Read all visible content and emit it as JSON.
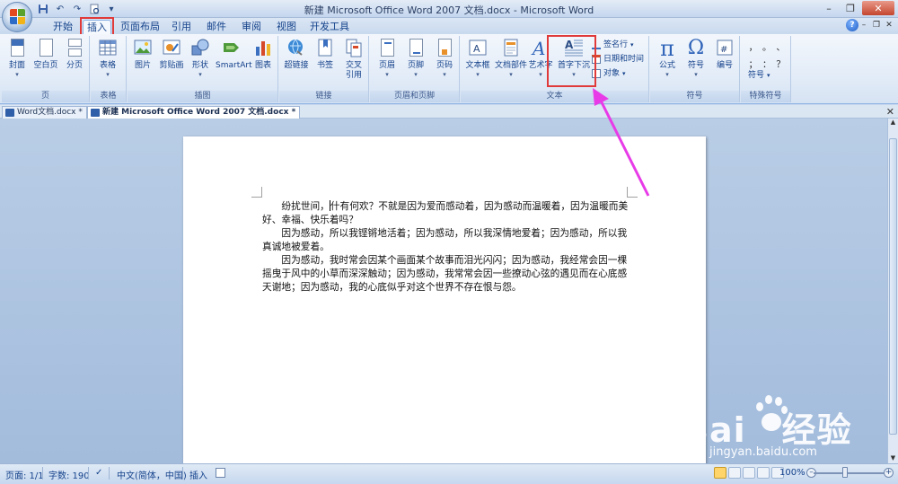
{
  "window": {
    "title": "新建 Microsoft Office Word 2007 文档.docx - Microsoft Word",
    "controls": {
      "minimize": "–",
      "restore": "❐",
      "close": "✕"
    }
  },
  "quick_access": {
    "save": "save-icon",
    "undo": "↶",
    "redo": "↷",
    "customize": "▾"
  },
  "ribbon_tabs": [
    {
      "label": "开始"
    },
    {
      "label": "插入"
    },
    {
      "label": "页面布局"
    },
    {
      "label": "引用"
    },
    {
      "label": "邮件"
    },
    {
      "label": "审阅"
    },
    {
      "label": "视图"
    },
    {
      "label": "开发工具"
    }
  ],
  "active_tab": "插入",
  "ribbon": {
    "groups": {
      "pages": "页",
      "tables": "表格",
      "illustrations": "插图",
      "links": "链接",
      "header_footer": "页眉和页脚",
      "text": "文本",
      "symbols": "符号",
      "special_symbols": "特殊符号"
    },
    "buttons": {
      "cover": "封面",
      "blank_page": "空白页",
      "page_break": "分页",
      "table": "表格",
      "picture": "图片",
      "clipart": "剪贴画",
      "shapes": "形状",
      "smartart": "SmartArt",
      "chart": "图表",
      "hyperlink": "超链接",
      "bookmark": "书签",
      "cross_ref_1": "交叉",
      "cross_ref_2": "引用",
      "header": "页眉",
      "footer": "页脚",
      "page_number": "页码",
      "textbox": "文本框",
      "quick_parts": "文档部件",
      "wordart": "艺术字",
      "dropcap": "首字下沉",
      "signature_line": "签名行",
      "date_time": "日期和时间",
      "object": "对象",
      "equation": "公式",
      "symbol": "符号",
      "number": "编号",
      "special_symbol": "符号"
    },
    "special_chars": [
      "，",
      "。",
      "、",
      "；",
      "：",
      "？"
    ]
  },
  "doc_tabs": [
    {
      "label": "Word文档.docx",
      "active": false
    },
    {
      "label": "新建 Microsoft Office Word 2007 文档.docx",
      "active": true
    }
  ],
  "document": {
    "paragraphs": [
      {
        "before_cursor": "纷扰世间，",
        "after_cursor": "什有何欢？不就是因为爱而感动着，因为感动而温暖着，因为温暖而美好、幸福、快乐着吗？"
      },
      {
        "text": "因为感动，所以我铿锵地活着；因为感动，所以我深情地爱着；因为感动，所以我真诚地被爱着。"
      },
      {
        "text": "因为感动，我时常会因某个画面某个故事而泪光闪闪；因为感动，我经常会因一棵摇曳于风中的小草而深深触动；因为感动，我常常会因一些撩动心弦的遇见而在心底感天谢地；因为感动，我的心底似乎对这个世界不存在恨与怨。"
      }
    ]
  },
  "status_bar": {
    "page": "页面: 1/1",
    "words": "字数: 190",
    "language": "中文(简体，中国)",
    "mode": "插入",
    "zoom": "100%"
  },
  "watermark": {
    "brand": "Bai",
    "brand_suffix": "经验",
    "url": "jingyan.baidu.com"
  },
  "colors": {
    "accent_red": "#e03a3a",
    "arrow_magenta": "#e83be8",
    "ribbon_bg": "#e3ecf8",
    "workspace_bg": "#a9c0de"
  }
}
